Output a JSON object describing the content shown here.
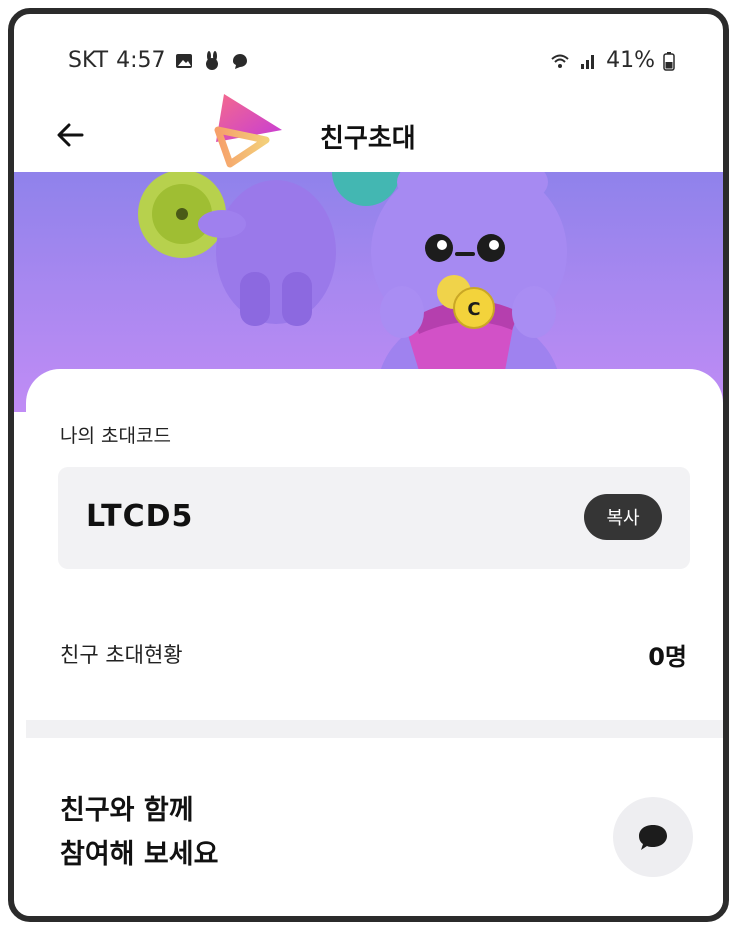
{
  "status_bar": {
    "carrier": "SKT",
    "time": "4:57",
    "battery": "41%"
  },
  "header": {
    "title": "친구초대"
  },
  "invite_code": {
    "label": "나의 초대코드",
    "code": "LTCD5",
    "copy_label": "복사"
  },
  "invite_status": {
    "label": "친구 초대현황",
    "value": "0명"
  },
  "cta": {
    "line1": "친구와 함께",
    "line2": "참여해 보세요"
  }
}
